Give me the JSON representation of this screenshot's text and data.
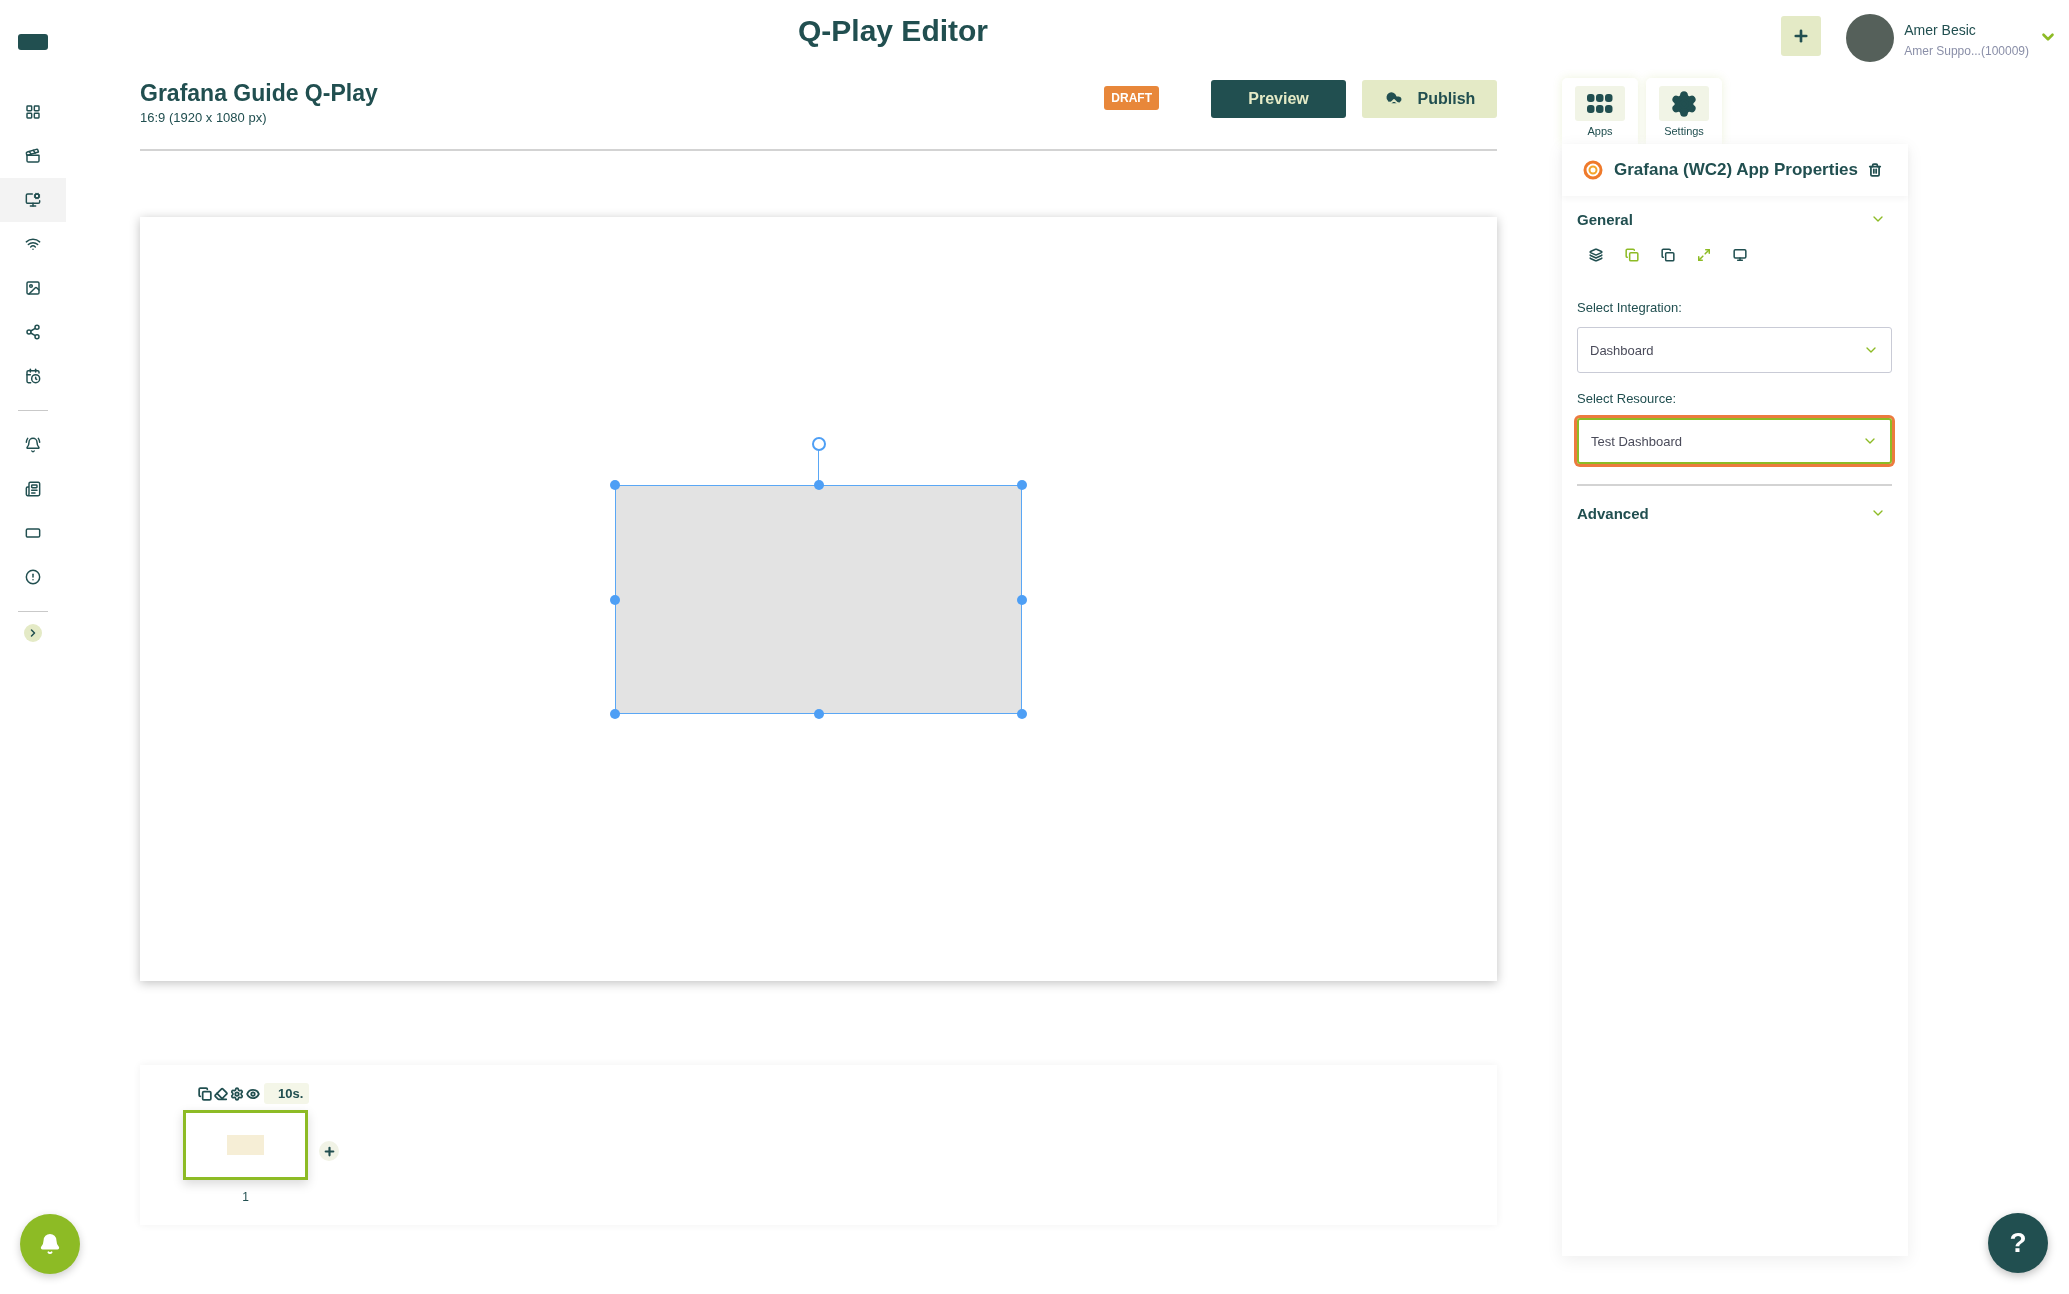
{
  "app_title": "Q-Play Editor",
  "user": {
    "name": "Amer Besic",
    "account": "Amer Suppo...(100009)"
  },
  "sidebar": {
    "groups": [
      [
        {
          "selected": false
        },
        {
          "selected": false
        },
        {
          "selected": true
        },
        {
          "selected": false
        },
        {
          "selected": false
        },
        {
          "selected": false
        },
        {
          "selected": false
        }
      ],
      [
        {
          "selected": false
        },
        {
          "selected": false
        },
        {
          "selected": false
        },
        {
          "selected": false
        }
      ]
    ]
  },
  "document": {
    "title": "Grafana Guide Q-Play",
    "size": "16:9 (1920 x 1080 px)",
    "status": "DRAFT"
  },
  "actions": [
    {
      "kind": "preview",
      "label": "Preview"
    },
    {
      "kind": "publish",
      "label": "Publish"
    }
  ],
  "canvas": {
    "elements": [
      {
        "selected": true
      }
    ]
  },
  "help_label": "?",
  "timeline": {
    "duration": "10s.",
    "slides": [
      {
        "number": "1",
        "selected": true
      }
    ]
  },
  "panel_tabs": [
    {
      "label": "Apps"
    },
    {
      "label": "Settings"
    }
  ],
  "properties": {
    "title": "Grafana (WC2) App Properties",
    "sections": [
      {
        "title": "General"
      },
      {
        "title": "Advanced"
      }
    ],
    "fields": [
      {
        "label": "Select Integration:",
        "value": "Dashboard",
        "highlighted": false
      },
      {
        "label": "Select Resource:",
        "value": "Test Dashboard",
        "highlighted": true
      }
    ]
  }
}
